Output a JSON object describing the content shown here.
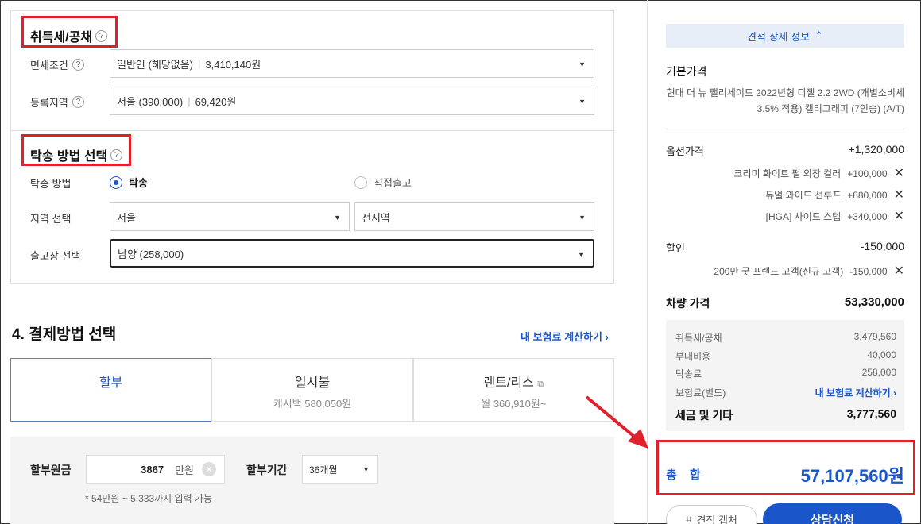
{
  "tax": {
    "title": "취득세/공채",
    "help": "?",
    "exemption_label": "면세조건",
    "exemption_value": "일반인 (해당없음)",
    "exemption_amount": "3,410,140원",
    "region_label": "등록지역",
    "region_value": "서울 (390,000)",
    "region_amount": "69,420원"
  },
  "delivery": {
    "title": "탁송 방법 선택",
    "help": "?",
    "method_label": "탁송 방법",
    "option_delivery": "탁송",
    "option_direct": "직접출고",
    "area_label": "지역 선택",
    "area_value": "서울",
    "area_sub_value": "전지역",
    "factory_label": "출고장 선택",
    "factory_value": "남양 (258,000)"
  },
  "payment": {
    "title": "4. 결제방법 선택",
    "insurance_link": "내 보험료 계산하기",
    "tabs": [
      {
        "name": "할부",
        "sub": ""
      },
      {
        "name": "일시불",
        "sub": "캐시백 580,050원"
      },
      {
        "name": "렌트/리스",
        "sub": "월 360,910원~"
      }
    ],
    "principal_label": "할부원금",
    "principal_value": "3867",
    "principal_unit": "만원",
    "period_label": "할부기간",
    "period_value": "36개월",
    "note": "* 54만원 ~ 5,333까지 입력 가능"
  },
  "summary": {
    "detail_toggle": "견적 상세 정보",
    "base_label": "기본가격",
    "car_desc": "현대 더 뉴 팰리세이드 2022년형 디젤 2.2 2WD (개별소비세 3.5% 적용) 캘리그래피 (7인승) (A/T)",
    "option_label": "옵션가격",
    "option_total": "+1,320,000",
    "options": [
      {
        "name": "크리미 화이트 펄 외장 컬러",
        "price": "+100,000"
      },
      {
        "name": "듀얼 와이드 선루프",
        "price": "+880,000"
      },
      {
        "name": "[HGA] 사이드 스텝",
        "price": "+340,000"
      }
    ],
    "discount_label": "할인",
    "discount_total": "-150,000",
    "discounts": [
      {
        "name": "200만 굿 프랜드 고객(신규 고객)",
        "price": "-150,000"
      }
    ],
    "car_price_label": "차량 가격",
    "car_price": "53,330,000",
    "tax_label": "취득세/공채",
    "tax_value": "3,479,560",
    "extra_label": "부대비용",
    "extra_value": "40,000",
    "delivery_label": "탁송료",
    "delivery_value": "258,000",
    "insurance_label": "보험료(별도)",
    "insurance_link": "내 보험료 계산하기",
    "etc_label": "세금 및 기타",
    "etc_value": "3,777,560",
    "total_label": "총 합",
    "total_value": "57,107,560원",
    "capture_button": "견적 캡처",
    "consult_button": "상담신청"
  },
  "colors": {
    "accent": "#1a56c9",
    "highlight": "#e0202a"
  }
}
